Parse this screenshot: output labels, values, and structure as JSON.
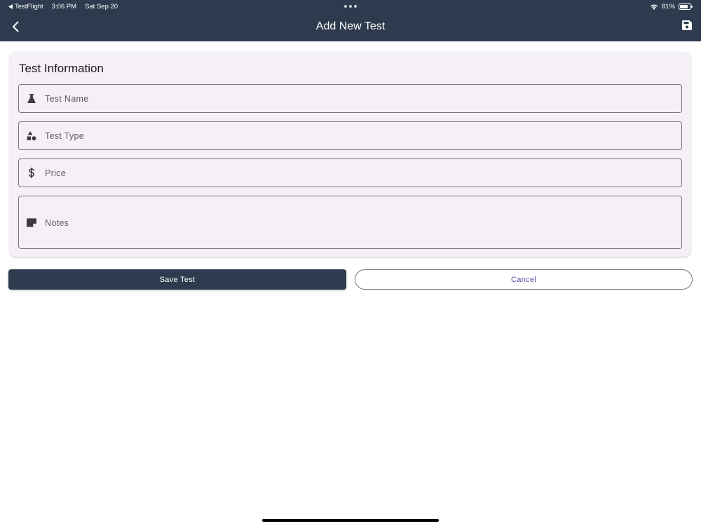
{
  "status_bar": {
    "back_app": "TestFlight",
    "time": "3:06 PM",
    "date": "Sat Sep 20",
    "battery": "81%",
    "battery_level": 0.81
  },
  "nav": {
    "title": "Add New Test",
    "back_icon": "chevron-left-icon",
    "save_icon": "floppy-disk-icon"
  },
  "form": {
    "section_title": "Test Information",
    "fields": [
      {
        "icon": "flask-icon",
        "placeholder": "Test Name",
        "value": ""
      },
      {
        "icon": "shapes-icon",
        "placeholder": "Test Type",
        "value": ""
      },
      {
        "icon": "dollar-icon",
        "placeholder": "Price",
        "value": ""
      },
      {
        "icon": "note-icon",
        "placeholder": "Notes",
        "value": ""
      }
    ]
  },
  "actions": {
    "save_label": "Save Test",
    "cancel_label": "Cancel"
  },
  "colors": {
    "header_bg": "#2e3b4e",
    "card_bg": "#f5f0f7",
    "cancel_text": "#5a4a9e"
  }
}
